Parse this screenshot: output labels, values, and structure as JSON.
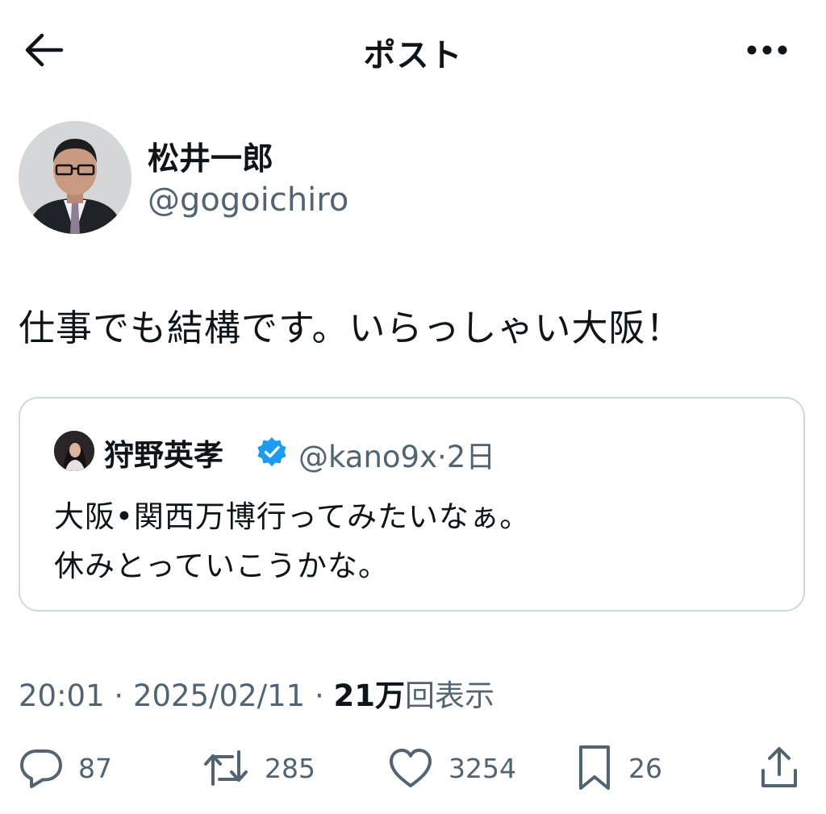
{
  "header": {
    "title": "ポスト",
    "back_icon": "arrow-left-icon",
    "more_icon": "more-horizontal-icon"
  },
  "author": {
    "display_name": "松井一郎",
    "handle": "@gogoichiro",
    "avatar": "avatar"
  },
  "post": {
    "text": "仕事でも結構です。いらっしゃい大阪！"
  },
  "quoted": {
    "display_name": "狩野英孝",
    "verified": true,
    "handle": "@kano9x",
    "separator": "·",
    "time": "2日",
    "lines": [
      "大阪•関西万博行ってみたいなぁ。",
      "休みとっていこうかな。"
    ],
    "badge_color": "#1d9bf0"
  },
  "meta": {
    "time": "20:01",
    "separator": "·",
    "date": "2025/02/11",
    "views_count": "21万",
    "views_label": "回表示"
  },
  "actions": {
    "replies": {
      "icon": "reply-icon",
      "count": "87"
    },
    "reposts": {
      "icon": "repost-icon",
      "count": "285"
    },
    "likes": {
      "icon": "heart-icon",
      "count": "3254"
    },
    "bookmarks": {
      "icon": "bookmark-icon",
      "count": "26"
    },
    "share": {
      "icon": "share-icon"
    }
  }
}
